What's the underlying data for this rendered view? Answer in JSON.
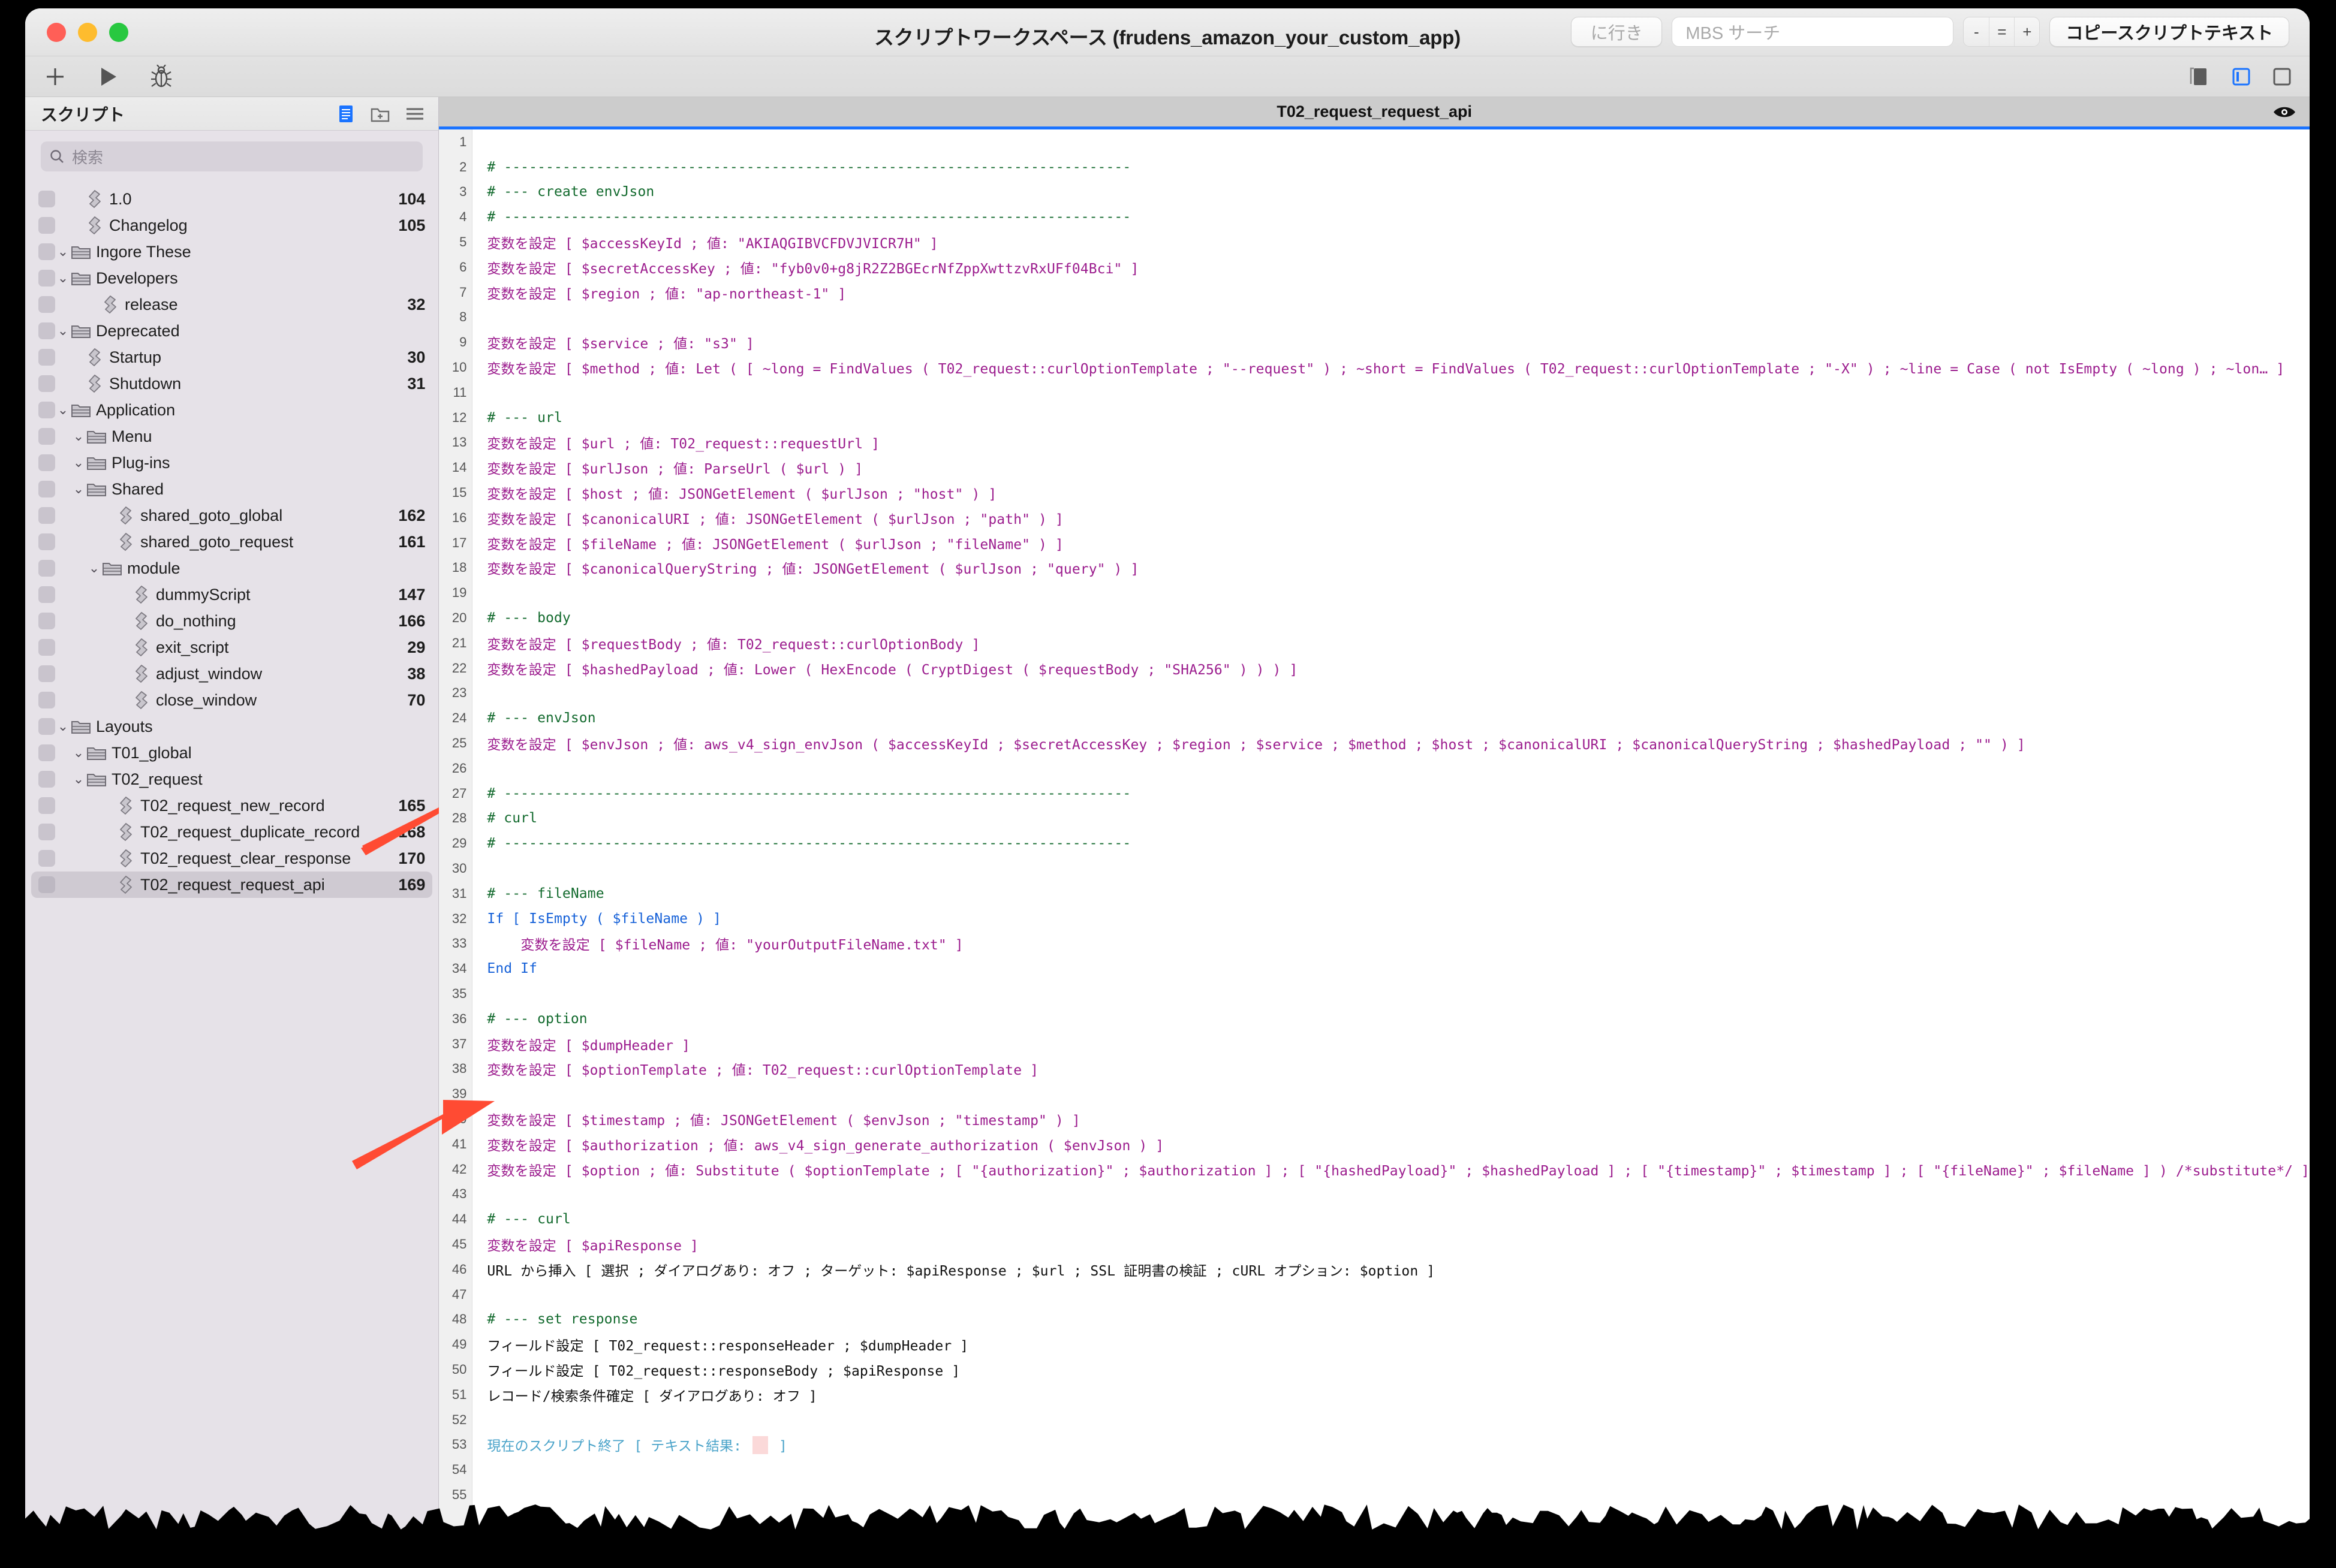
{
  "window": {
    "title": "スクリプトワークスペース (frudens_amazon_your_custom_app)",
    "traffic_lights": {
      "close": "close-button",
      "minimize": "minimize-button",
      "zoom": "zoom-button"
    }
  },
  "toolbar": {
    "goto_label": "に行き",
    "search_placeholder": "MBS サーチ",
    "zoom_minus": "-",
    "zoom_equal": "=",
    "zoom_plus": "+",
    "copy_script_text_label": "コピースクリプトテキスト",
    "accent_color": "#1a73ff"
  },
  "toolbar2": {
    "new_script": "plus-icon",
    "run_script": "play-icon",
    "debug_script": "bug-icon",
    "duplicate_panel": "copy-panel-icon",
    "left_panel": "left-panel-icon",
    "right_panel": "right-panel-icon"
  },
  "sidebar": {
    "title": "スクリプト",
    "search_placeholder": "検索",
    "header_icons": [
      "script-list-icon",
      "new-folder-icon",
      "menu-lines-icon"
    ],
    "items": [
      {
        "label": "1.0",
        "type": "script",
        "depth": 1,
        "count": "104",
        "selected": false
      },
      {
        "label": "Changelog",
        "type": "script",
        "depth": 1,
        "count": "105",
        "selected": false
      },
      {
        "label": "Ingore These",
        "type": "folder",
        "depth": 0,
        "count": "",
        "selected": false
      },
      {
        "label": "Developers",
        "type": "folder",
        "depth": 0,
        "count": "",
        "selected": false
      },
      {
        "label": "release",
        "type": "script",
        "depth": 2,
        "count": "32",
        "selected": false
      },
      {
        "label": "Deprecated",
        "type": "folder",
        "depth": 0,
        "count": "",
        "selected": false
      },
      {
        "label": "Startup",
        "type": "script",
        "depth": 1,
        "count": "30",
        "selected": false
      },
      {
        "label": "Shutdown",
        "type": "script",
        "depth": 1,
        "count": "31",
        "selected": false
      },
      {
        "label": "Application",
        "type": "folder",
        "depth": 0,
        "count": "",
        "selected": false
      },
      {
        "label": "Menu",
        "type": "folder",
        "depth": 1,
        "count": "",
        "selected": false
      },
      {
        "label": "Plug-ins",
        "type": "folder",
        "depth": 1,
        "count": "",
        "selected": false
      },
      {
        "label": "Shared",
        "type": "folder",
        "depth": 1,
        "count": "",
        "selected": false
      },
      {
        "label": "shared_goto_global",
        "type": "script",
        "depth": 3,
        "count": "162",
        "selected": false
      },
      {
        "label": "shared_goto_request",
        "type": "script",
        "depth": 3,
        "count": "161",
        "selected": false
      },
      {
        "label": "module",
        "type": "folder",
        "depth": 2,
        "count": "",
        "selected": false
      },
      {
        "label": "dummyScript",
        "type": "script",
        "depth": 4,
        "count": "147",
        "selected": false
      },
      {
        "label": "do_nothing",
        "type": "script",
        "depth": 4,
        "count": "166",
        "selected": false
      },
      {
        "label": "exit_script",
        "type": "script",
        "depth": 4,
        "count": "29",
        "selected": false
      },
      {
        "label": "adjust_window",
        "type": "script",
        "depth": 4,
        "count": "38",
        "selected": false
      },
      {
        "label": "close_window",
        "type": "script",
        "depth": 4,
        "count": "70",
        "selected": false
      },
      {
        "label": "Layouts",
        "type": "folder",
        "depth": 0,
        "count": "",
        "selected": false
      },
      {
        "label": "T01_global",
        "type": "folder",
        "depth": 1,
        "count": "",
        "selected": false
      },
      {
        "label": "T02_request",
        "type": "folder",
        "depth": 1,
        "count": "",
        "selected": false
      },
      {
        "label": "T02_request_new_record",
        "type": "script",
        "depth": 3,
        "count": "165",
        "selected": false
      },
      {
        "label": "T02_request_duplicate_record",
        "type": "script",
        "depth": 3,
        "count": "168",
        "selected": false
      },
      {
        "label": "T02_request_clear_response",
        "type": "script",
        "depth": 3,
        "count": "170",
        "selected": false
      },
      {
        "label": "T02_request_request_api",
        "type": "script",
        "depth": 3,
        "count": "169",
        "selected": true
      }
    ]
  },
  "editor": {
    "tab_label": "T02_request_request_api",
    "visibility_icon": "eye-icon",
    "lines": [
      {
        "n": "1",
        "cls": "c-plain",
        "text": ""
      },
      {
        "n": "2",
        "cls": "c-comment",
        "text": "# ---------------------------------------------------------------------------"
      },
      {
        "n": "3",
        "cls": "c-comment",
        "text": "# --- create envJson"
      },
      {
        "n": "4",
        "cls": "c-comment",
        "text": "# ---------------------------------------------------------------------------"
      },
      {
        "n": "5",
        "cls": "c-set",
        "text": "変数を設定 [ $accessKeyId ; 値: \"AKIAQGIBVCFDVJVICR7H\" ]"
      },
      {
        "n": "6",
        "cls": "c-set",
        "text": "変数を設定 [ $secretAccessKey ; 値: \"fyb0v0+g8jR2Z2BGEcrNfZppXwttzvRxUFf04Bci\" ]"
      },
      {
        "n": "7",
        "cls": "c-set",
        "text": "変数を設定 [ $region ; 値: \"ap-northeast-1\" ]"
      },
      {
        "n": "8",
        "cls": "c-plain",
        "text": ""
      },
      {
        "n": "9",
        "cls": "c-set",
        "text": "変数を設定 [ $service ; 値: \"s3\" ]"
      },
      {
        "n": "10",
        "cls": "c-set",
        "text": "変数を設定 [ $method ; 値: Let ( [   ~long = FindValues ( T02_request::curlOptionTemplate ; \"--request\" ) ;   ~short = FindValues ( T02_request::curlOptionTemplate ; \"-X\" ) ;   ~line =    Case (      not IsEmpty ( ~long ) ; ~lon… ]"
      },
      {
        "n": "11",
        "cls": "c-plain",
        "text": ""
      },
      {
        "n": "12",
        "cls": "c-comment",
        "text": "# --- url"
      },
      {
        "n": "13",
        "cls": "c-set",
        "text": "変数を設定 [ $url ; 値: T02_request::requestUrl ]"
      },
      {
        "n": "14",
        "cls": "c-set",
        "text": "変数を設定 [ $urlJson ; 値: ParseUrl ( $url ) ]"
      },
      {
        "n": "15",
        "cls": "c-set",
        "text": "変数を設定 [ $host ; 値: JSONGetElement ( $urlJson ; \"host\" ) ]"
      },
      {
        "n": "16",
        "cls": "c-set",
        "text": "変数を設定 [ $canonicalURI ; 値: JSONGetElement ( $urlJson ; \"path\" ) ]"
      },
      {
        "n": "17",
        "cls": "c-set",
        "text": "変数を設定 [ $fileName ; 値: JSONGetElement ( $urlJson ; \"fileName\" ) ]"
      },
      {
        "n": "18",
        "cls": "c-set",
        "text": "変数を設定 [ $canonicalQueryString ; 値: JSONGetElement ( $urlJson ; \"query\" ) ]"
      },
      {
        "n": "19",
        "cls": "c-plain",
        "text": ""
      },
      {
        "n": "20",
        "cls": "c-comment",
        "text": "# --- body"
      },
      {
        "n": "21",
        "cls": "c-set",
        "text": "変数を設定 [ $requestBody ; 値: T02_request::curlOptionBody ]"
      },
      {
        "n": "22",
        "cls": "c-set",
        "text": "変数を設定 [ $hashedPayload ; 値: Lower ( HexEncode ( CryptDigest ( $requestBody ; \"SHA256\" ) ) ) ]"
      },
      {
        "n": "23",
        "cls": "c-plain",
        "text": ""
      },
      {
        "n": "24",
        "cls": "c-comment",
        "text": "# --- envJson"
      },
      {
        "n": "25",
        "cls": "c-set",
        "text": "変数を設定 [ $envJson ; 値: aws_v4_sign_envJson ( $accessKeyId ; $secretAccessKey ; $region ; $service ; $method ; $host ; $canonicalURI ; $canonicalQueryString ; $hashedPayload ; \"\" ) ]"
      },
      {
        "n": "26",
        "cls": "c-plain",
        "text": ""
      },
      {
        "n": "27",
        "cls": "c-comment",
        "text": "# ---------------------------------------------------------------------------"
      },
      {
        "n": "28",
        "cls": "c-comment",
        "text": "# curl"
      },
      {
        "n": "29",
        "cls": "c-comment",
        "text": "# ---------------------------------------------------------------------------"
      },
      {
        "n": "30",
        "cls": "c-plain",
        "text": ""
      },
      {
        "n": "31",
        "cls": "c-comment",
        "text": "# --- fileName"
      },
      {
        "n": "32",
        "cls": "c-ctrl",
        "text": "If [ IsEmpty ( $fileName ) ]"
      },
      {
        "n": "33",
        "cls": "c-set",
        "text": "変数を設定 [ $fileName ; 値: \"yourOutputFileName.txt\" ]",
        "indent": 1
      },
      {
        "n": "34",
        "cls": "c-ctrl",
        "text": "End If"
      },
      {
        "n": "35",
        "cls": "c-plain",
        "text": ""
      },
      {
        "n": "36",
        "cls": "c-comment",
        "text": "# --- option"
      },
      {
        "n": "37",
        "cls": "c-set",
        "text": "変数を設定 [ $dumpHeader ]"
      },
      {
        "n": "38",
        "cls": "c-set",
        "text": "変数を設定 [ $optionTemplate ; 値: T02_request::curlOptionTemplate ]"
      },
      {
        "n": "39",
        "cls": "c-plain",
        "text": ""
      },
      {
        "n": "40",
        "cls": "c-set",
        "text": "変数を設定 [ $timestamp ; 値: JSONGetElement ( $envJson ; \"timestamp\" ) ]"
      },
      {
        "n": "41",
        "cls": "c-set",
        "text": "変数を設定 [ $authorization ; 値: aws_v4_sign_generate_authorization ( $envJson ) ]"
      },
      {
        "n": "42",
        "cls": "c-set",
        "text": "変数を設定 [ $option ; 値: Substitute (   $optionTemplate ;   [ \"{authorization}\" ; $authorization ] ;   [ \"{hashedPayload}\" ; $hashedPayload ] ;   [ \"{timestamp}\" ; $timestamp ] ;   [ \"{fileName}\" ; $fileName ] ) /*substitute*/ ]"
      },
      {
        "n": "43",
        "cls": "c-plain",
        "text": ""
      },
      {
        "n": "44",
        "cls": "c-comment",
        "text": "# --- curl"
      },
      {
        "n": "45",
        "cls": "c-set",
        "text": "変数を設定 [ $apiResponse ]"
      },
      {
        "n": "46",
        "cls": "c-plain",
        "text": "URL から挿入 [ 選択 ; ダイアログあり: オフ ; ターゲット: $apiResponse ; $url ; SSL 証明書の検証 ; cURL オプション: $option ]"
      },
      {
        "n": "47",
        "cls": "c-plain",
        "text": ""
      },
      {
        "n": "48",
        "cls": "c-comment",
        "text": "# --- set response"
      },
      {
        "n": "49",
        "cls": "c-plain",
        "text": "フィールド設定 [ T02_request::responseHeader ; $dumpHeader ]"
      },
      {
        "n": "50",
        "cls": "c-plain",
        "text": "フィールド設定 [ T02_request::responseBody ; $apiResponse ]"
      },
      {
        "n": "51",
        "cls": "c-plain",
        "text": "レコード/検索条件確定 [ ダイアログあり: オフ ]"
      },
      {
        "n": "52",
        "cls": "c-plain",
        "text": ""
      },
      {
        "n": "53",
        "cls": "c-var",
        "text": "現在のスクリプト終了 [ テキスト結果: ",
        "pinkbox": true,
        "after": " ]"
      },
      {
        "n": "54",
        "cls": "c-plain",
        "text": ""
      },
      {
        "n": "55",
        "cls": "c-plain",
        "text": ""
      }
    ]
  },
  "annotations": {
    "arrow_color": "#ff4b33",
    "arrow_targets": [
      "line-25",
      "line-41"
    ]
  }
}
